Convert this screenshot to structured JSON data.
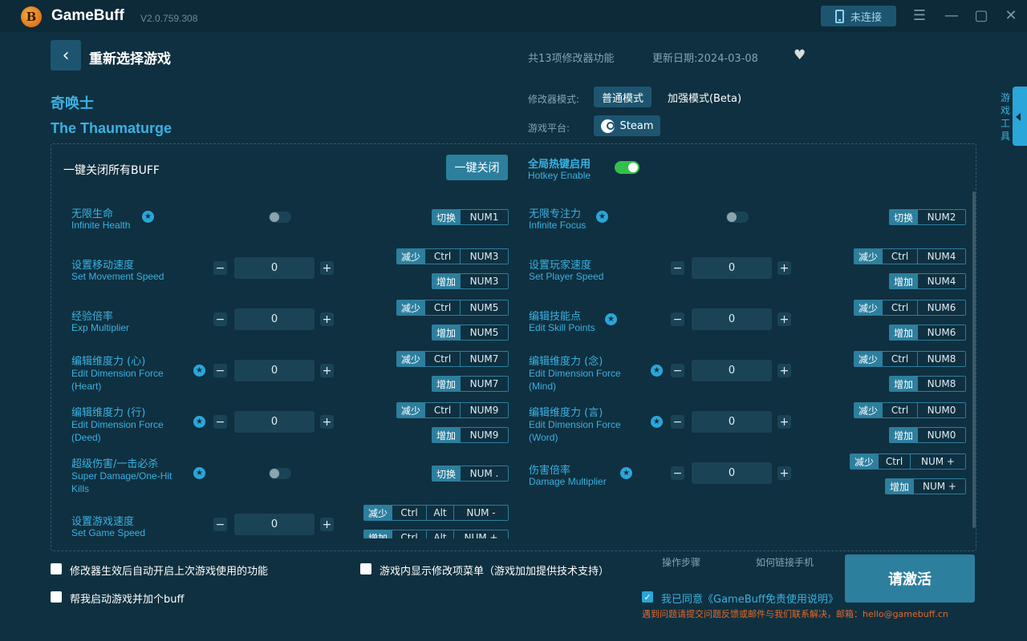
{
  "app": {
    "name": "GameBuff",
    "version": "V2.0.759.308",
    "connect_label": "未连接"
  },
  "header": {
    "title": "重新选择游戏",
    "feature_count": "共13项修改器功能",
    "update_date": "更新日期:2024-03-08"
  },
  "game": {
    "name_cn": "奇唤士",
    "name_en": "The Thaumaturge"
  },
  "mode": {
    "label": "修改器模式:",
    "normal": "普通模式",
    "enhanced": "加强模式(Beta)",
    "platform_label": "游戏平台:",
    "platform": "Steam"
  },
  "side_tab": "游戏工具",
  "controls": {
    "close_all_label": "一键关闭所有BUFF",
    "close_all_button": "一键关闭",
    "hotkey_cn": "全局热键启用",
    "hotkey_en": "Hotkey Enable"
  },
  "cheats": [
    {
      "cn": "无限生命",
      "en": "Infinite Health",
      "toggle_key": "切换",
      "key": "NUM1"
    },
    {
      "cn": "无限专注力",
      "en": "Infinite Focus",
      "toggle_key": "切换",
      "key": "NUM2"
    },
    {
      "cn": "设置移动速度",
      "en": "Set Movement Speed",
      "value": "0",
      "dec": "减少",
      "inc": "增加",
      "mod": "Ctrl",
      "key_dec": "NUM3",
      "key_inc": "NUM3"
    },
    {
      "cn": "设置玩家速度",
      "en": "Set Player Speed",
      "value": "0",
      "dec": "减少",
      "inc": "增加",
      "mod": "Ctrl",
      "key_dec": "NUM4",
      "key_inc": "NUM4"
    },
    {
      "cn": "经验倍率",
      "en": "Exp Multiplier",
      "value": "0",
      "dec": "减少",
      "inc": "增加",
      "mod": "Ctrl",
      "key_dec": "NUM5",
      "key_inc": "NUM5"
    },
    {
      "cn": "编辑技能点",
      "en": "Edit Skill Points",
      "value": "0",
      "dec": "减少",
      "inc": "增加",
      "mod": "Ctrl",
      "key_dec": "NUM6",
      "key_inc": "NUM6"
    },
    {
      "cn": "编辑维度力 (心)",
      "en1": "Edit Dimension Force",
      "en2": "(Heart)",
      "value": "0",
      "dec": "减少",
      "inc": "增加",
      "mod": "Ctrl",
      "key_dec": "NUM7",
      "key_inc": "NUM7"
    },
    {
      "cn": "编辑维度力 (念)",
      "en1": "Edit Dimension Force",
      "en2": "(Mind)",
      "value": "0",
      "dec": "减少",
      "inc": "增加",
      "mod": "Ctrl",
      "key_dec": "NUM8",
      "key_inc": "NUM8"
    },
    {
      "cn": "编辑维度力 (行)",
      "en1": "Edit Dimension Force",
      "en2": "(Deed)",
      "value": "0",
      "dec": "减少",
      "inc": "增加",
      "mod": "Ctrl",
      "key_dec": "NUM9",
      "key_inc": "NUM9"
    },
    {
      "cn": "编辑维度力 (言)",
      "en1": "Edit Dimension Force",
      "en2": "(Word)",
      "value": "0",
      "dec": "减少",
      "inc": "增加",
      "mod": "Ctrl",
      "key_dec": "NUM0",
      "key_inc": "NUM0"
    },
    {
      "cn": "超级伤害/一击必杀",
      "en1": "Super Damage/One-Hit",
      "en2": "Kills",
      "toggle_key": "切换",
      "key": "NUM ."
    },
    {
      "cn": "伤害倍率",
      "en": "Damage Multiplier",
      "value": "0",
      "dec": "减少",
      "inc": "增加",
      "mod": "Ctrl",
      "key_dec": "NUM +",
      "key_inc": "NUM +"
    },
    {
      "cn": "设置游戏速度",
      "en": "Set Game Speed",
      "value": "0",
      "dec": "减少",
      "inc": "增加",
      "mod": "Ctrl",
      "mod2": "Alt",
      "key_dec": "NUM -",
      "key_inc": "NUM +"
    }
  ],
  "footer": {
    "auto_enable": "修改器生效后自动开启上次游戏使用的功能",
    "ingame_menu": "游戏内显示修改项菜单（游戏加加提供技术支持）",
    "launch_help": "帮我启动游戏并加个buff",
    "steps_link": "操作步骤",
    "phone_link": "如何链接手机",
    "activate": "请激活",
    "agree": "我已同意《GameBuff免责使用说明》",
    "contact": "遇到问题请提交问题反馈或邮件与我们联系解决，邮箱：hello@gamebuff.cn"
  },
  "colors": {
    "accent": "#3bb1e1",
    "button": "#2d7f9e",
    "bg": "#0f3040",
    "contact": "#e26a2c"
  }
}
